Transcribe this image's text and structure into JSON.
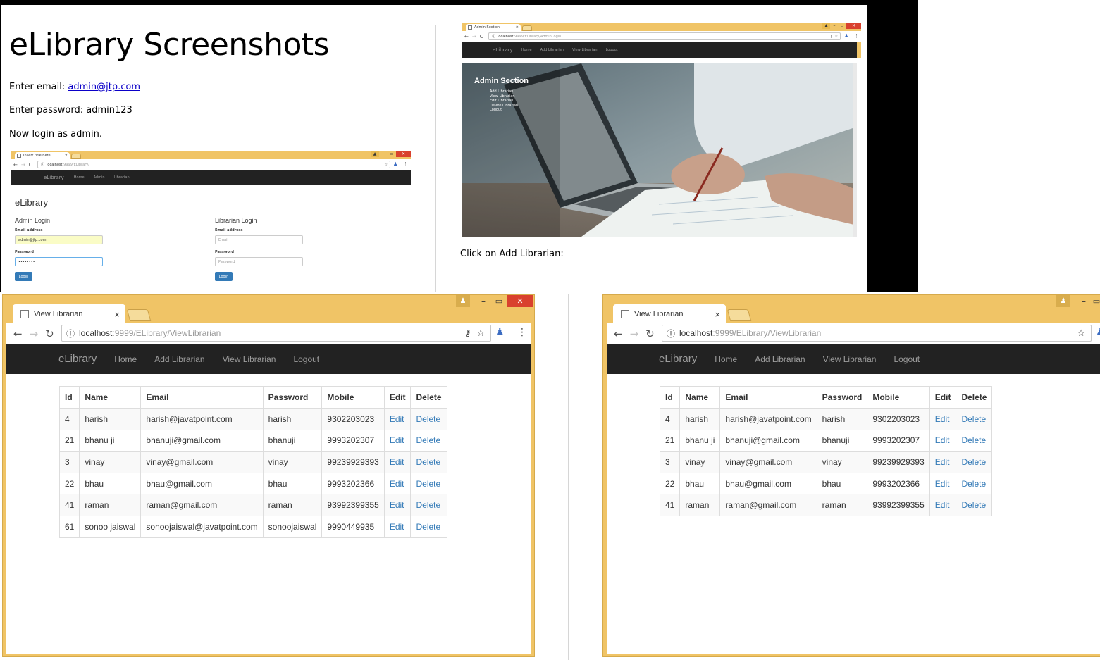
{
  "document": {
    "title": "eLibrary Screenshots",
    "email_prefix": "Enter email: ",
    "email_link": "admin@jtp.com",
    "password_line": "Enter password: admin123",
    "login_line": "Now login as admin.",
    "click_line": "Click on Add Librarian:"
  },
  "login_window": {
    "tab_title": "Insert title here",
    "url_host": "localhost",
    "url_rest": ":9999/ELibrary/",
    "nav": {
      "brand": "eLibrary",
      "links": [
        "Home",
        "Admin",
        "Librarian"
      ]
    },
    "heading": "eLibrary",
    "admin": {
      "title": "Admin Login",
      "email_label": "Email address",
      "email_value": "admin@jtp.com",
      "password_label": "Password",
      "password_value": "••••••••",
      "button": "Login"
    },
    "librarian": {
      "title": "Librarian Login",
      "email_label": "Email address",
      "email_placeholder": "Email",
      "password_label": "Password",
      "password_placeholder": "Password",
      "button": "Login"
    }
  },
  "admin_window": {
    "tab_title": "Admin Section",
    "url_host": "localhost",
    "url_rest": ":9999/ELibrary/AdminLogin",
    "nav": {
      "brand": "eLibrary",
      "links": [
        "Home",
        "Add Librarian",
        "View Librarian",
        "Logout"
      ]
    },
    "section_title": "Admin Section",
    "menu": [
      "Add Librarian",
      "View Librarian",
      "Edit Librarian",
      "Delete Librarian",
      "Logout"
    ]
  },
  "view_window_left": {
    "tab_title": "View Librarian",
    "url_host": "localhost",
    "url_rest": ":9999/ELibrary/ViewLibrarian",
    "nav": {
      "brand": "eLibrary",
      "links": [
        "Home",
        "Add Librarian",
        "View Librarian",
        "Logout"
      ]
    },
    "columns": [
      "Id",
      "Name",
      "Email",
      "Password",
      "Mobile",
      "Edit",
      "Delete"
    ],
    "rows": [
      [
        "4",
        "harish",
        "harish@javatpoint.com",
        "harish",
        "9302203023",
        "Edit",
        "Delete"
      ],
      [
        "21",
        "bhanu ji",
        "bhanuji@gmail.com",
        "bhanuji",
        "9993202307",
        "Edit",
        "Delete"
      ],
      [
        "3",
        "vinay",
        "vinay@gmail.com",
        "vinay",
        "99239929393",
        "Edit",
        "Delete"
      ],
      [
        "22",
        "bhau",
        "bhau@gmail.com",
        "bhau",
        "9993202366",
        "Edit",
        "Delete"
      ],
      [
        "41",
        "raman",
        "raman@gmail.com",
        "raman",
        "93992399355",
        "Edit",
        "Delete"
      ],
      [
        "61",
        "sonoo jaiswal",
        "sonoojaiswal@javatpoint.com",
        "sonoojaiswal",
        "9990449935",
        "Edit",
        "Delete"
      ]
    ]
  },
  "view_window_right": {
    "tab_title": "View Librarian",
    "url_host": "localhost",
    "url_rest": ":9999/ELibrary/ViewLibrarian",
    "nav": {
      "brand": "eLibrary",
      "links": [
        "Home",
        "Add Librarian",
        "View Librarian",
        "Logout"
      ]
    },
    "columns": [
      "Id",
      "Name",
      "Email",
      "Password",
      "Mobile",
      "Edit",
      "Delete"
    ],
    "rows": [
      [
        "4",
        "harish",
        "harish@javatpoint.com",
        "harish",
        "9302203023",
        "Edit",
        "Delete"
      ],
      [
        "21",
        "bhanu ji",
        "bhanuji@gmail.com",
        "bhanuji",
        "9993202307",
        "Edit",
        "Delete"
      ],
      [
        "3",
        "vinay",
        "vinay@gmail.com",
        "vinay",
        "99239929393",
        "Edit",
        "Delete"
      ],
      [
        "22",
        "bhau",
        "bhau@gmail.com",
        "bhau",
        "9993202366",
        "Edit",
        "Delete"
      ],
      [
        "41",
        "raman",
        "raman@gmail.com",
        "raman",
        "93992399355",
        "Edit",
        "Delete"
      ]
    ]
  },
  "colors": {
    "chrome_frame": "#f0c466",
    "navbar": "#222222",
    "link": "#337ab7",
    "close": "#d9412e"
  },
  "icons": [
    "back-arrow-icon",
    "forward-arrow-icon",
    "reload-icon",
    "info-icon",
    "key-icon",
    "star-icon",
    "profile-icon",
    "menu-icon",
    "page-icon",
    "close-icon"
  ]
}
